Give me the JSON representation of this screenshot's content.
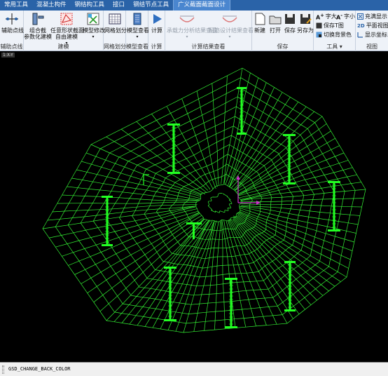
{
  "tabs": [
    {
      "label": "常用工具",
      "active": false
    },
    {
      "label": "混凝土构件",
      "active": false
    },
    {
      "label": "钢结构工具",
      "active": false
    },
    {
      "label": "接口",
      "active": false
    },
    {
      "label": "钢结节点工具",
      "active": false
    },
    {
      "label": "广义截面截面设计",
      "active": true
    }
  ],
  "ribbon": {
    "aux": {
      "button": "辅助点线",
      "group": "辅助点线"
    },
    "model": {
      "group": "建模",
      "combo_label": "组合截",
      "param_label": "参数化建模",
      "irregular_label": "任意形状截面",
      "free_label": "自由建模",
      "modify_label": "模型修改"
    },
    "mesh": {
      "button": "网格划分",
      "group": "网格划分"
    },
    "view": {
      "button": "模型查看",
      "group": "模型查看"
    },
    "calc": {
      "button": "计算",
      "group": "计算"
    },
    "results": {
      "group": "计算结果查看",
      "capacity_label": "承载力分析结果查看",
      "rebar_label": "配筋设计结果查看"
    },
    "save": {
      "group": "保存",
      "new": "新建",
      "open": "打开",
      "save": "保存",
      "save_as": "另存为"
    },
    "tools": {
      "group": "工具",
      "font_bigger": "字大",
      "font_smaller": "字小",
      "save_image": "保存T图",
      "switch_bg": "切换背景色"
    },
    "viewgrp": {
      "group": "视图",
      "fill": "充满显示",
      "plan": "平面视图",
      "coords": "显示坐标系"
    }
  },
  "viewport": {
    "label": "1:X-Y"
  },
  "command_line": "GSD_CHANGE_BACK_COLOR",
  "colors": {
    "mesh": "#33ee33",
    "tab_bg": "#2a63a8",
    "active_tab": "#4a86cf",
    "ribbon_bg": "#eef2f8",
    "axis": "#cc33cc",
    "canvas": "#000000"
  }
}
